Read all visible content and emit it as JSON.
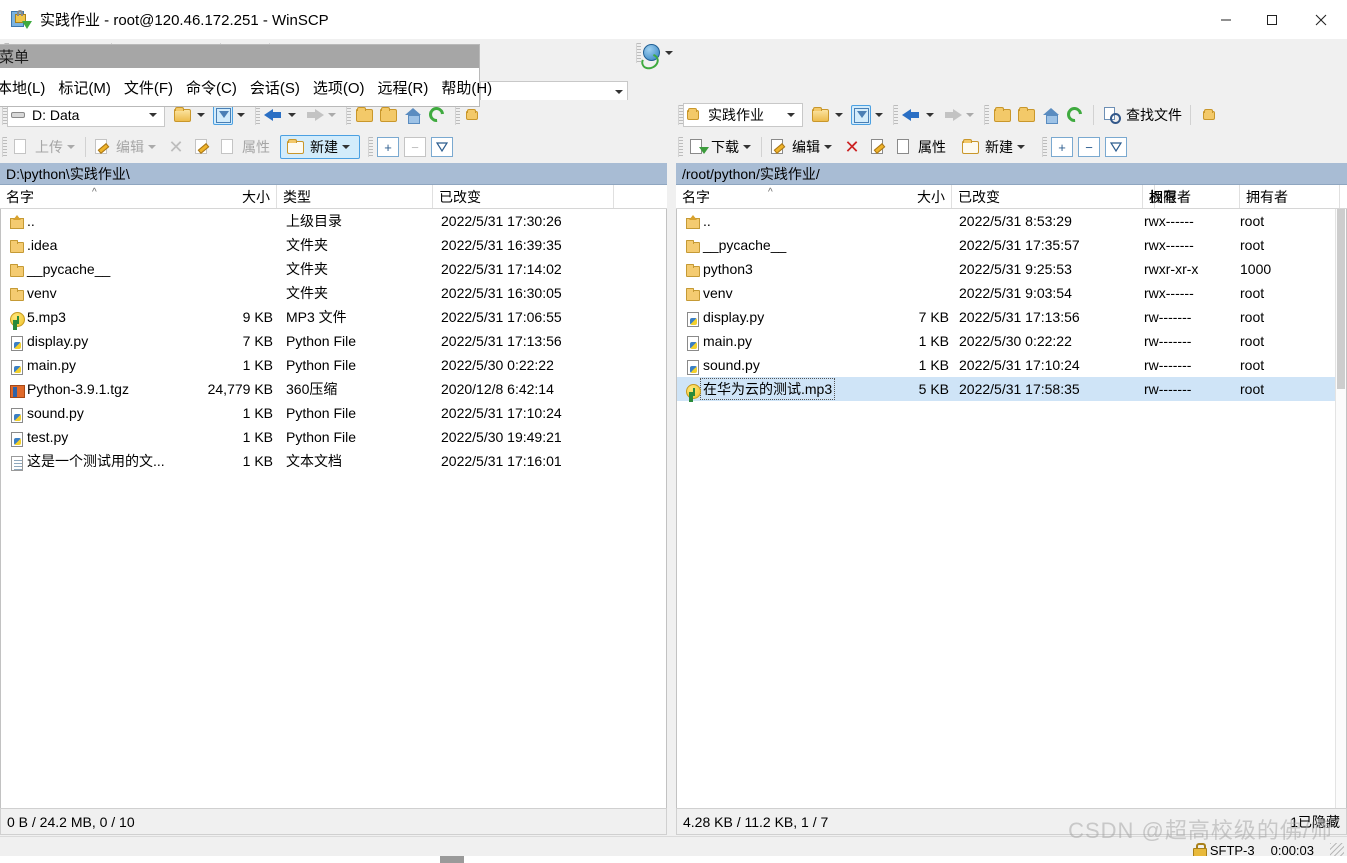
{
  "window": {
    "title": "实践作业 - root@120.46.172.251 - WinSCP",
    "icon": "winscp-lock-icon",
    "minimize": "—",
    "maximize": "▫",
    "close": "✕"
  },
  "menu_popup": {
    "header": "菜单",
    "items": [
      "本地(L)",
      "标记(M)",
      "文件(F)",
      "命令(C)",
      "会话(S)",
      "选项(O)",
      "远程(R)",
      "帮助(H)"
    ]
  },
  "left_toolbar": {
    "drive_label": "D: Data",
    "buttons": [
      {
        "label": "上传",
        "icon": "upload-icon",
        "enabled": false,
        "dropdown": true
      },
      {
        "label": "编辑",
        "icon": "edit-icon",
        "enabled": false,
        "dropdown": true
      },
      {
        "label": "",
        "icon": "delete-x-icon",
        "enabled": false,
        "dropdown": false
      },
      {
        "label": "",
        "icon": "rename-icon",
        "enabled": false,
        "dropdown": false
      },
      {
        "label": "",
        "icon": "duplicate-icon",
        "enabled": false,
        "dropdown": false
      },
      {
        "label": "属性",
        "icon": "properties-icon",
        "enabled": false,
        "dropdown": false
      },
      {
        "label": "新建",
        "icon": "new-folder-icon",
        "enabled": true,
        "dropdown": true,
        "highlighted": true
      }
    ],
    "select_plus": "+",
    "select_minus": "−",
    "select_invert": "⍢"
  },
  "right_toolbar": {
    "path_label": "实践作业",
    "find_files": "查找文件",
    "buttons": [
      {
        "label": "下载",
        "icon": "download-icon",
        "enabled": true,
        "dropdown": true
      },
      {
        "label": "编辑",
        "icon": "edit-icon",
        "enabled": true,
        "dropdown": true
      },
      {
        "label": "",
        "icon": "delete-x-icon",
        "enabled": true,
        "dropdown": false
      },
      {
        "label": "",
        "icon": "rename-icon",
        "enabled": true,
        "dropdown": false
      },
      {
        "label": "",
        "icon": "duplicate-icon",
        "enabled": true,
        "dropdown": false
      },
      {
        "label": "属性",
        "icon": "properties-icon",
        "enabled": true,
        "dropdown": false
      },
      {
        "label": "新建",
        "icon": "new-folder-icon",
        "enabled": true,
        "dropdown": true
      }
    ],
    "select_plus": "+",
    "select_minus": "−",
    "select_invert": "⍢"
  },
  "left_panel": {
    "path": "D:\\python\\实践作业\\",
    "columns": [
      "名字",
      "大小",
      "类型",
      "已改变"
    ],
    "sort_indicator": "^",
    "rows": [
      {
        "icon": "parent-dir-icon",
        "name": "..",
        "size": "",
        "type": "上级目录",
        "modified": "2022/5/31  17:30:26"
      },
      {
        "icon": "folder-icon",
        "name": ".idea",
        "size": "",
        "type": "文件夹",
        "modified": "2022/5/31  16:39:35"
      },
      {
        "icon": "folder-icon",
        "name": "__pycache__",
        "size": "",
        "type": "文件夹",
        "modified": "2022/5/31  17:14:02"
      },
      {
        "icon": "folder-icon",
        "name": "venv",
        "size": "",
        "type": "文件夹",
        "modified": "2022/5/31  16:30:05"
      },
      {
        "icon": "mp3-icon",
        "name": "5.mp3",
        "size": "9 KB",
        "type": "MP3 文件",
        "modified": "2022/5/31  17:06:55"
      },
      {
        "icon": "python-icon",
        "name": "display.py",
        "size": "7 KB",
        "type": "Python File",
        "modified": "2022/5/31  17:13:56"
      },
      {
        "icon": "python-icon",
        "name": "main.py",
        "size": "1 KB",
        "type": "Python File",
        "modified": "2022/5/30  0:22:22"
      },
      {
        "icon": "archive-icon",
        "name": "Python-3.9.1.tgz",
        "size": "24,779 KB",
        "type": "360压缩",
        "modified": "2020/12/8  6:42:14"
      },
      {
        "icon": "python-icon",
        "name": "sound.py",
        "size": "1 KB",
        "type": "Python File",
        "modified": "2022/5/31  17:10:24"
      },
      {
        "icon": "python-icon",
        "name": "test.py",
        "size": "1 KB",
        "type": "Python File",
        "modified": "2022/5/30  19:49:21"
      },
      {
        "icon": "text-icon",
        "name": "这是一个测试用的文...",
        "size": "1 KB",
        "type": "文本文档",
        "modified": "2022/5/31  17:16:01"
      }
    ],
    "status": "0 B / 24.2 MB,  0 / 10"
  },
  "right_panel": {
    "path": "/root/python/实践作业/",
    "columns": [
      "名字",
      "大小",
      "已改变",
      "权限",
      "拥有者"
    ],
    "sort_indicator": "^",
    "rows": [
      {
        "icon": "parent-dir-icon",
        "name": "..",
        "size": "",
        "modified": "2022/5/31 8:53:29",
        "rights": "rwx------",
        "owner": "root",
        "selected": false
      },
      {
        "icon": "folder-icon",
        "name": "__pycache__",
        "size": "",
        "modified": "2022/5/31 17:35:57",
        "rights": "rwx------",
        "owner": "root",
        "selected": false
      },
      {
        "icon": "folder-icon",
        "name": "python3",
        "size": "",
        "modified": "2022/5/31 9:25:53",
        "rights": "rwxr-xr-x",
        "owner": "1000",
        "selected": false
      },
      {
        "icon": "folder-icon",
        "name": "venv",
        "size": "",
        "modified": "2022/5/31 9:03:54",
        "rights": "rwx------",
        "owner": "root",
        "selected": false
      },
      {
        "icon": "python-icon",
        "name": "display.py",
        "size": "7 KB",
        "modified": "2022/5/31 17:13:56",
        "rights": "rw-------",
        "owner": "root",
        "selected": false
      },
      {
        "icon": "python-icon",
        "name": "main.py",
        "size": "1 KB",
        "modified": "2022/5/30 0:22:22",
        "rights": "rw-------",
        "owner": "root",
        "selected": false
      },
      {
        "icon": "python-icon",
        "name": "sound.py",
        "size": "1 KB",
        "modified": "2022/5/31 17:10:24",
        "rights": "rw-------",
        "owner": "root",
        "selected": false
      },
      {
        "icon": "mp3-icon",
        "name": "在华为云的测试.mp3",
        "size": "5 KB",
        "modified": "2022/5/31 17:58:35",
        "rights": "rw-------",
        "owner": "root",
        "selected": true
      }
    ],
    "status": "4.28 KB / 11.2 KB,  1 / 7",
    "status_right": "1已隐藏"
  },
  "bottom_bar": {
    "protocol": "SFTP-3",
    "duration": "0:00:03",
    "lock_icon": "lock-icon"
  },
  "watermark": "CSDN @超高校级的佛/师",
  "colors": {
    "path_bar": "#a8bcd4",
    "selection": "#cfe4f7",
    "toolbar_bg": "#f0f0f0",
    "menu_popup_header": "#a6a6a6",
    "accent_button": "#d3ecfb"
  }
}
